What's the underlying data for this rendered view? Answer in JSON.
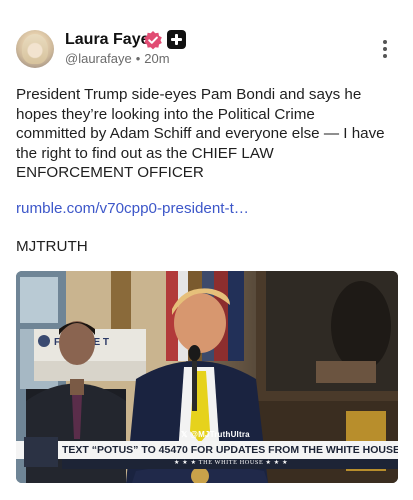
{
  "author": {
    "name": "Laura Faye",
    "handle": "@laurafaye",
    "separator": "•",
    "time": "20m",
    "verified_color": "#e14c73"
  },
  "post": {
    "text": "President Trump side-eyes Pam Bondi and says he hopes they’re looking into the Political Crime committed by Adam Schiff and everyone else — I have the right to find out as the CHIEF LAW ENFORCEMENT OFFICER",
    "link": "rumble.com/v70cpp0-president-t…",
    "tag": "MJTRUTH"
  },
  "media": {
    "watermark": "𝕏 @MJTruthUltra",
    "banner_text": "TEXT “POTUS” TO 45470 FOR UPDATES FROM THE WHITE HOUSE",
    "banner_sub": "★ ★ ★  THE WHITE HOUSE  ★ ★ ★",
    "backdrop_sign": "FE   ER HE T"
  },
  "colors": {
    "link": "#3d57c9",
    "banner_navy": "#1d2436"
  }
}
